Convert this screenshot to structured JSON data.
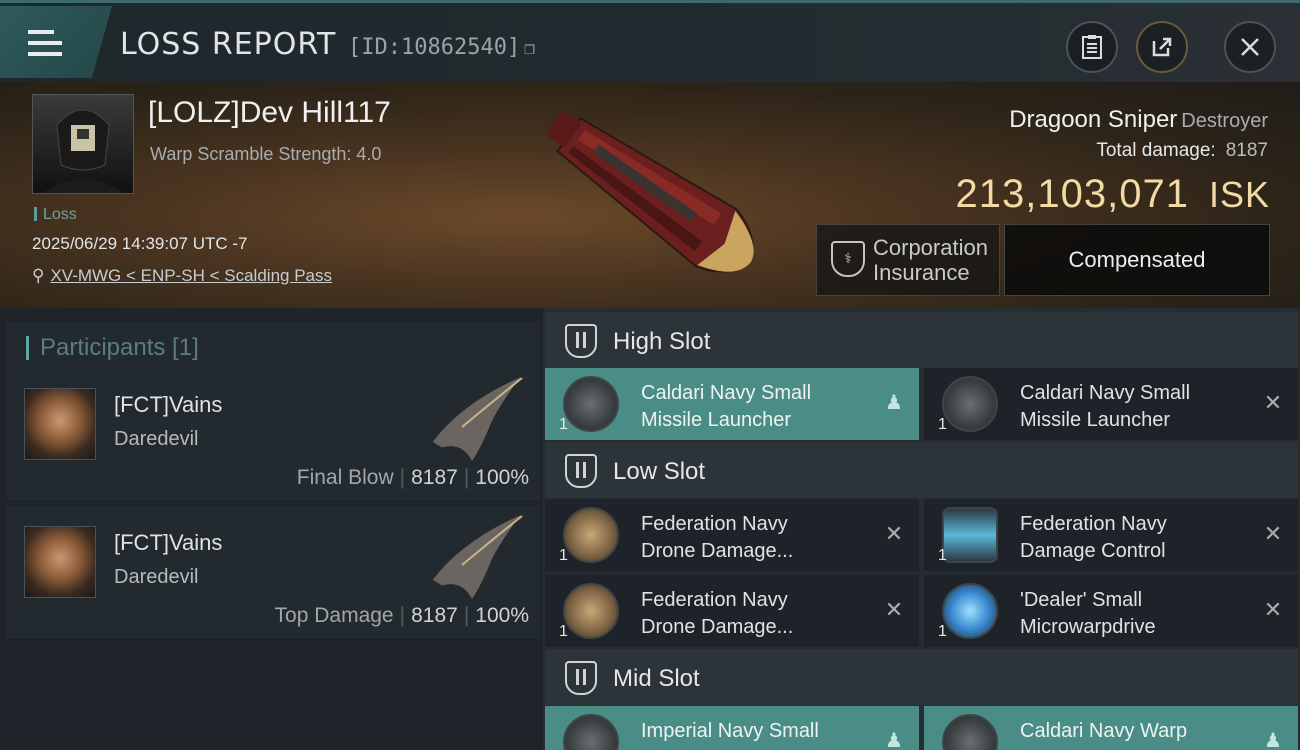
{
  "header": {
    "title": "LOSS REPORT",
    "report_id": "[ID:10862540]",
    "icons": [
      "menu-icon",
      "clipboard-icon",
      "share-icon",
      "close-icon"
    ]
  },
  "victim": {
    "name": "[LOLZ]Dev Hill117",
    "warp_scramble": "Warp Scramble Strength: 4.0",
    "status": "Loss",
    "datetime": "2025/06/29 14:39:07 UTC -7",
    "location": "XV-MWG < ENP-SH < Scalding Pass"
  },
  "ship": {
    "name": "Dragoon Sniper",
    "class": "Destroyer",
    "total_damage_label": "Total damage:",
    "total_damage": "8187",
    "isk_value": "213,103,071",
    "isk_unit": "ISK"
  },
  "insurance": {
    "corp_line1": "Corporation",
    "corp_line2": "Insurance",
    "compensated": "Compensated"
  },
  "participants": {
    "header": "Participants [1]",
    "rows": [
      {
        "name": "[FCT]Vains",
        "ship": "Daredevil",
        "label": "Final Blow",
        "damage": "8187",
        "percent": "100%"
      },
      {
        "name": "[FCT]Vains",
        "ship": "Daredevil",
        "label": "Top Damage",
        "damage": "8187",
        "percent": "100%"
      }
    ]
  },
  "slots": {
    "high": {
      "title": "High Slot",
      "modules": [
        {
          "line1": "Caldari Navy Small",
          "line2": "Missile Launcher",
          "qty": "1"
        },
        {
          "line1": "Caldari Navy Small",
          "line2": "Missile Launcher",
          "qty": "1"
        }
      ]
    },
    "low": {
      "title": "Low Slot",
      "modules": [
        {
          "line1": "Federation Navy",
          "line2": "Drone Damage...",
          "qty": "1"
        },
        {
          "line1": "Federation Navy",
          "line2": "Damage Control",
          "qty": "1"
        },
        {
          "line1": "Federation Navy",
          "line2": "Drone Damage...",
          "qty": "1"
        },
        {
          "line1": "'Dealer' Small",
          "line2": "Microwarpdrive",
          "qty": "1"
        }
      ]
    },
    "mid": {
      "title": "Mid Slot",
      "modules": [
        {
          "line1": "Imperial Navy Small",
          "line2": "",
          "qty": ""
        },
        {
          "line1": "Caldari Navy Warp",
          "line2": "",
          "qty": ""
        }
      ]
    }
  },
  "colors": {
    "accent": "#4a8d86",
    "isk": "#f3d9a4",
    "loss_tag": "#6fa3a0"
  }
}
